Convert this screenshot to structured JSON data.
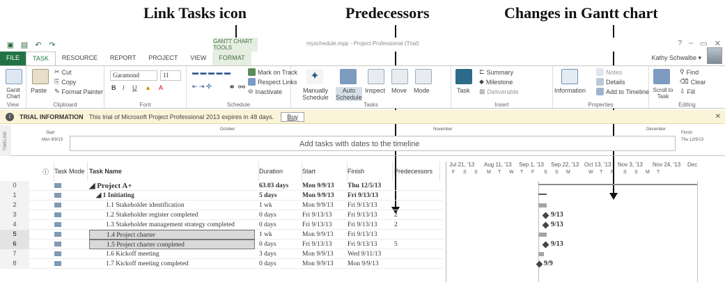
{
  "annotations": {
    "link_tasks": "Link Tasks icon",
    "predecessors": "Predecessors",
    "changes": "Changes in Gantt chart"
  },
  "window": {
    "context_tab": "GANTT CHART TOOLS",
    "title": "myschedule.mpp - Project Professional (Trial)",
    "user": "Kathy Schwalbe ▾",
    "help": "?"
  },
  "tabs": [
    "FILE",
    "TASK",
    "RESOURCE",
    "REPORT",
    "PROJECT",
    "VIEW",
    "FORMAT"
  ],
  "ribbon": {
    "view_group": "View",
    "gantt_chart": "Gantt Chart",
    "paste": "Paste",
    "cut": "Cut",
    "copy": "Copy",
    "format_painter": "Format Painter",
    "clipboard_group": "Clipboard",
    "font_name": "Garamond",
    "font_size": "11",
    "font_group": "Font",
    "mark_on_track": "Mark on Track",
    "respect_links": "Respect Links",
    "inactivate": "Inactivate",
    "schedule_group": "Schedule",
    "manually_schedule": "Manually Schedule",
    "auto_schedule": "Auto Schedule",
    "inspect": "Inspect",
    "move": "Move",
    "mode": "Mode",
    "tasks_group": "Tasks",
    "task": "Task",
    "summary": "Summary",
    "milestone": "Milestone",
    "deliverable": "Deliverable",
    "insert_group": "Insert",
    "information": "Information",
    "notes": "Notes",
    "details": "Details",
    "add_to_timeline": "Add to Timeline",
    "properties_group": "Properties",
    "scroll_to_task": "Scroll to Task",
    "find": "Find",
    "clear": "Clear",
    "fill": "Fill",
    "editing_group": "Editing"
  },
  "infobar": {
    "title": "TRIAL INFORMATION",
    "message": "This trial of Microsoft Project Professional 2013 expires in 48 days.",
    "buy": "Buy"
  },
  "timeline": {
    "side_label": "TIMELINE",
    "start_label": "Start",
    "start_date": "Mon 9/9/13",
    "finish_label": "Finish",
    "finish_date": "Thu 12/5/13",
    "month1": "October",
    "month2": "November",
    "month3": "December",
    "message": "Add tasks with dates to the timeline"
  },
  "grid": {
    "headers": {
      "info": "ⓘ",
      "mode": "Task Mode",
      "name": "Task Name",
      "duration": "Duration",
      "start": "Start",
      "finish": "Finish",
      "predecessors": "Predecessors"
    },
    "rows": [
      {
        "id": "0",
        "name": "◢ Project A+",
        "duration": "63.03 days",
        "start": "Mon 9/9/13",
        "finish": "Thu 12/5/13",
        "pred": ""
      },
      {
        "id": "1",
        "name": "◢ 1 Initiating",
        "duration": "5 days",
        "start": "Mon 9/9/13",
        "finish": "Fri 9/13/13",
        "pred": ""
      },
      {
        "id": "2",
        "name": "1.1 Stakeholder identification",
        "duration": "1 wk",
        "start": "Mon 9/9/13",
        "finish": "Fri 9/13/13",
        "pred": ""
      },
      {
        "id": "3",
        "name": "1.2 Stakeholder register completed",
        "duration": "0 days",
        "start": "Fri 9/13/13",
        "finish": "Fri 9/13/13",
        "pred": "2"
      },
      {
        "id": "4",
        "name": "1.3 Stakeholder management strategy completed",
        "duration": "0 days",
        "start": "Fri 9/13/13",
        "finish": "Fri 9/13/13",
        "pred": "2"
      },
      {
        "id": "5",
        "name": "1.4 Project charter",
        "duration": "1 wk",
        "start": "Mon 9/9/13",
        "finish": "Fri 9/13/13",
        "pred": ""
      },
      {
        "id": "6",
        "name": "1.5 Project charter completed",
        "duration": "0 days",
        "start": "Fri 9/13/13",
        "finish": "Fri 9/13/13",
        "pred": "5"
      },
      {
        "id": "7",
        "name": "1.6 Kickoff meeting",
        "duration": "3 days",
        "start": "Mon 9/9/13",
        "finish": "Wed 9/11/13",
        "pred": ""
      },
      {
        "id": "8",
        "name": "1.7 Kickoff meeting completed",
        "duration": "0 days",
        "start": "Mon 9/9/13",
        "finish": "Mon 9/9/13",
        "pred": ""
      }
    ]
  },
  "chart": {
    "weeks": [
      "Jul 21, '13",
      "Aug 11, '13",
      "Sep 1, '13",
      "Sep 22, '13",
      "Oct 13, '13",
      "Nov 3, '13",
      "Nov 24, '13",
      "Dec"
    ],
    "days": [
      "F",
      "S",
      "S",
      "M",
      "T",
      "W",
      "T",
      "F",
      "S",
      "S",
      "M",
      "W",
      "T",
      "F",
      "S",
      "S",
      "M",
      "T"
    ],
    "milestone_labels": [
      "9/13",
      "9/13",
      "9/13",
      "9/9"
    ]
  }
}
